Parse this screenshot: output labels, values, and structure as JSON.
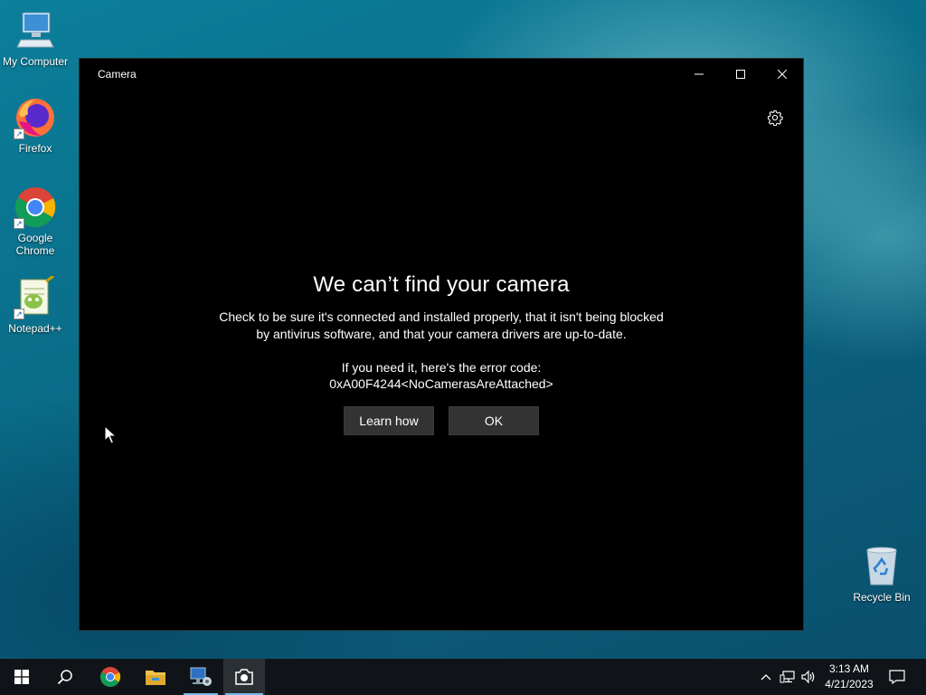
{
  "desktop": {
    "icons": [
      {
        "label": "My Computer"
      },
      {
        "label": "Firefox"
      },
      {
        "label": "Google Chrome"
      },
      {
        "label": "Notepad++"
      },
      {
        "label": "Recycle Bin"
      }
    ]
  },
  "window": {
    "title": "Camera",
    "heading": "We can’t find your camera",
    "message_line1": "Check to be sure it's connected and installed properly, that it isn't being blocked",
    "message_line2": "by antivirus software, and that your camera drivers are up-to-date.",
    "error_label": "If you need it, here's the error code:",
    "error_code": "0xA00F4244<NoCamerasAreAttached>",
    "learn_how_label": "Learn how",
    "ok_label": "OK"
  },
  "taskbar": {
    "apps": [
      {
        "icon": "windows-start-icon"
      },
      {
        "icon": "search-icon"
      },
      {
        "icon": "chrome-icon"
      },
      {
        "icon": "file-explorer-icon"
      },
      {
        "icon": "network-config-icon"
      },
      {
        "icon": "camera-icon",
        "active": true
      }
    ],
    "time": "3:13 AM",
    "date": "4/21/2023"
  },
  "colors": {
    "window_bg": "#000000",
    "button_bg": "#333333",
    "taskbar_bg": "#101418",
    "accent": "#76b9ed"
  }
}
